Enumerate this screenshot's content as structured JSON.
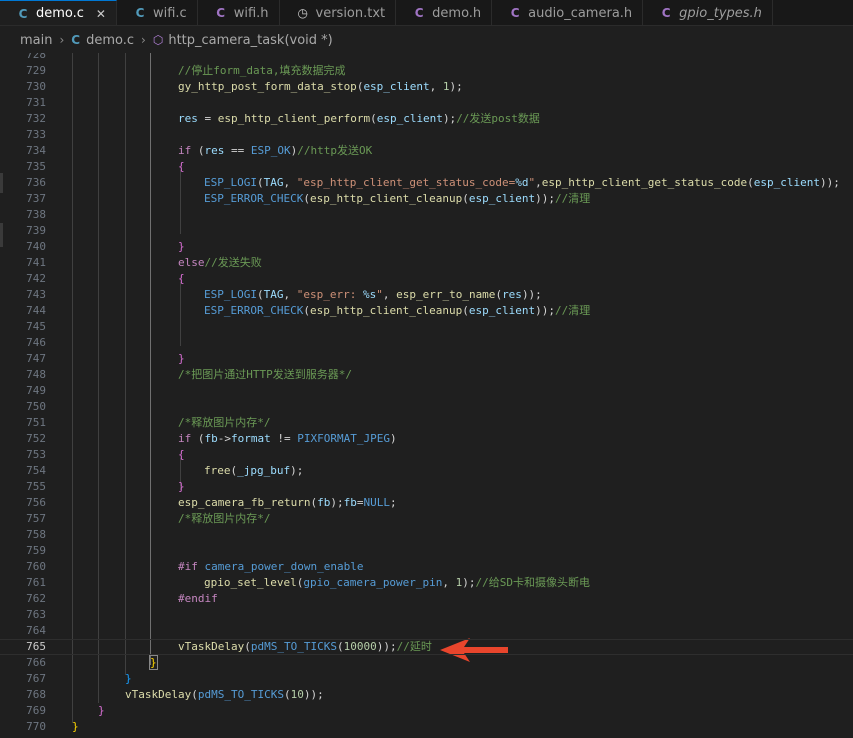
{
  "tabs": [
    {
      "label": "demo.c",
      "icon": "c-file-icon",
      "glyph": "C",
      "active": true
    },
    {
      "label": "wifi.c",
      "icon": "c-file-icon",
      "glyph": "C",
      "active": false
    },
    {
      "label": "wifi.h",
      "icon": "h-file-icon",
      "glyph": "C",
      "active": false
    },
    {
      "label": "version.txt",
      "icon": "txt-file-icon",
      "glyph": "◷",
      "active": false
    },
    {
      "label": "demo.h",
      "icon": "h-file-icon",
      "glyph": "C",
      "active": false
    },
    {
      "label": "audio_camera.h",
      "icon": "h-file-icon",
      "glyph": "C",
      "active": false
    },
    {
      "label": "gpio_types.h",
      "icon": "h-file-icon",
      "glyph": "C",
      "active": false
    }
  ],
  "tab_close_glyph": "✕",
  "breadcrumb": {
    "folder": "main",
    "file": "demo.c",
    "file_glyph": "C",
    "symbol": "http_camera_task(void *)",
    "symbol_glyph": "⬡",
    "sep": "›"
  },
  "current_line": 765,
  "lines": [
    {
      "n": "728",
      "segs": []
    },
    {
      "n": "729",
      "segs": [
        [
          "cm",
          "//停止form_data,填充数据完成"
        ]
      ]
    },
    {
      "n": "730",
      "segs": [
        [
          "fn",
          "gy_http_post_form_data_stop"
        ],
        [
          "p",
          "("
        ],
        [
          "var",
          "esp_client"
        ],
        [
          "p",
          ", "
        ],
        [
          "num",
          "1"
        ],
        [
          "p",
          ");"
        ]
      ]
    },
    {
      "n": "731",
      "segs": []
    },
    {
      "n": "732",
      "segs": [
        [
          "var",
          "res"
        ],
        [
          "p",
          " = "
        ],
        [
          "fn",
          "esp_http_client_perform"
        ],
        [
          "p",
          "("
        ],
        [
          "var",
          "esp_client"
        ],
        [
          "p",
          ");"
        ],
        [
          "cm",
          "//发送post数据"
        ]
      ]
    },
    {
      "n": "733",
      "segs": []
    },
    {
      "n": "734",
      "segs": [
        [
          "kw",
          "if"
        ],
        [
          "p",
          " ("
        ],
        [
          "var",
          "res"
        ],
        [
          "p",
          " == "
        ],
        [
          "mac",
          "ESP_OK"
        ],
        [
          "p",
          ")"
        ],
        [
          "cm",
          "//http发送OK"
        ]
      ]
    },
    {
      "n": "735",
      "segs": [
        [
          "brace",
          "{"
        ]
      ]
    },
    {
      "n": "736",
      "segs": [
        [
          "mac",
          "ESP_LOGI"
        ],
        [
          "p",
          "("
        ],
        [
          "var",
          "TAG"
        ],
        [
          "p",
          ", "
        ],
        [
          "str",
          "\"esp_http_client_get_status_code="
        ],
        [
          "fmt",
          "%d"
        ],
        [
          "str",
          "\""
        ],
        [
          "p",
          ","
        ],
        [
          "fn",
          "esp_http_client_get_status_code"
        ],
        [
          "p",
          "("
        ],
        [
          "var",
          "esp_client"
        ],
        [
          "p",
          "));"
        ]
      ]
    },
    {
      "n": "737",
      "segs": [
        [
          "mac",
          "ESP_ERROR_CHECK"
        ],
        [
          "p",
          "("
        ],
        [
          "fn",
          "esp_http_client_cleanup"
        ],
        [
          "p",
          "("
        ],
        [
          "var",
          "esp_client"
        ],
        [
          "p",
          "));"
        ],
        [
          "cm",
          "//清理"
        ]
      ]
    },
    {
      "n": "738",
      "segs": []
    },
    {
      "n": "739",
      "segs": []
    },
    {
      "n": "740",
      "segs": [
        [
          "brace",
          "}"
        ]
      ]
    },
    {
      "n": "741",
      "segs": [
        [
          "kw",
          "else"
        ],
        [
          "cm",
          "//发送失败"
        ]
      ]
    },
    {
      "n": "742",
      "segs": [
        [
          "brace",
          "{"
        ]
      ]
    },
    {
      "n": "743",
      "segs": [
        [
          "mac",
          "ESP_LOGI"
        ],
        [
          "p",
          "("
        ],
        [
          "var",
          "TAG"
        ],
        [
          "p",
          ", "
        ],
        [
          "str",
          "\"esp_err: "
        ],
        [
          "fmt",
          "%s"
        ],
        [
          "str",
          "\""
        ],
        [
          "p",
          ", "
        ],
        [
          "fn",
          "esp_err_to_name"
        ],
        [
          "p",
          "("
        ],
        [
          "var",
          "res"
        ],
        [
          "p",
          "));"
        ]
      ]
    },
    {
      "n": "744",
      "segs": [
        [
          "mac",
          "ESP_ERROR_CHECK"
        ],
        [
          "p",
          "("
        ],
        [
          "fn",
          "esp_http_client_cleanup"
        ],
        [
          "p",
          "("
        ],
        [
          "var",
          "esp_client"
        ],
        [
          "p",
          "));"
        ],
        [
          "cm",
          "//清理"
        ]
      ]
    },
    {
      "n": "745",
      "segs": []
    },
    {
      "n": "746",
      "segs": []
    },
    {
      "n": "747",
      "segs": [
        [
          "brace",
          "}"
        ]
      ]
    },
    {
      "n": "748",
      "segs": [
        [
          "cm",
          "/*把图片通过HTTP发送到服务器*/"
        ]
      ]
    },
    {
      "n": "749",
      "segs": []
    },
    {
      "n": "750",
      "segs": []
    },
    {
      "n": "751",
      "segs": [
        [
          "cm",
          "/*释放图片内存*/"
        ]
      ]
    },
    {
      "n": "752",
      "segs": [
        [
          "kw",
          "if"
        ],
        [
          "p",
          " ("
        ],
        [
          "var",
          "fb"
        ],
        [
          "p",
          "->"
        ],
        [
          "var",
          "format"
        ],
        [
          "p",
          " != "
        ],
        [
          "mac",
          "PIXFORMAT_JPEG"
        ],
        [
          "p",
          ")"
        ]
      ]
    },
    {
      "n": "753",
      "segs": [
        [
          "brace",
          "{"
        ]
      ]
    },
    {
      "n": "754",
      "segs": [
        [
          "fn",
          "free"
        ],
        [
          "p",
          "("
        ],
        [
          "var",
          "_jpg_buf"
        ],
        [
          "p",
          ");"
        ]
      ]
    },
    {
      "n": "755",
      "segs": [
        [
          "brace",
          "}"
        ]
      ]
    },
    {
      "n": "756",
      "segs": [
        [
          "fn",
          "esp_camera_fb_return"
        ],
        [
          "p",
          "("
        ],
        [
          "var",
          "fb"
        ],
        [
          "p",
          ");"
        ],
        [
          "var",
          "fb"
        ],
        [
          "p",
          "="
        ],
        [
          "mac",
          "NULL"
        ],
        [
          "p",
          ";"
        ]
      ]
    },
    {
      "n": "757",
      "segs": [
        [
          "cm",
          "/*释放图片内存*/"
        ]
      ]
    },
    {
      "n": "758",
      "segs": []
    },
    {
      "n": "759",
      "segs": []
    },
    {
      "n": "760",
      "segs": [
        [
          "pp",
          "#if"
        ],
        [
          "p",
          " "
        ],
        [
          "mac",
          "camera_power_down_enable"
        ]
      ]
    },
    {
      "n": "761",
      "segs": [
        [
          "fn",
          "gpio_set_level"
        ],
        [
          "p",
          "("
        ],
        [
          "mac",
          "gpio_camera_power_pin"
        ],
        [
          "p",
          ", "
        ],
        [
          "num",
          "1"
        ],
        [
          "p",
          ");"
        ],
        [
          "cm",
          "//给SD卡和摄像头断电"
        ]
      ]
    },
    {
      "n": "762",
      "segs": [
        [
          "pp",
          "#endif"
        ]
      ]
    },
    {
      "n": "763",
      "segs": []
    },
    {
      "n": "764",
      "segs": []
    },
    {
      "n": "765",
      "segs": [
        [
          "fn",
          "vTaskDelay"
        ],
        [
          "p",
          "("
        ],
        [
          "mac",
          "pdMS_TO_TICKS"
        ],
        [
          "p",
          "("
        ],
        [
          "num",
          "10000"
        ],
        [
          "p",
          "));"
        ],
        [
          "cm",
          "//延时"
        ]
      ]
    },
    {
      "n": "766",
      "segs": [
        [
          "brace3",
          "}"
        ]
      ]
    },
    {
      "n": "767",
      "segs": [
        [
          "brace2",
          "}"
        ]
      ]
    },
    {
      "n": "768",
      "segs": [
        [
          "fn",
          "vTaskDelay"
        ],
        [
          "p",
          "("
        ],
        [
          "mac",
          "pdMS_TO_TICKS"
        ],
        [
          "p",
          "("
        ],
        [
          "num",
          "10"
        ],
        [
          "p",
          "));"
        ]
      ]
    },
    {
      "n": "769",
      "segs": [
        [
          "brace",
          "}"
        ]
      ]
    },
    {
      "n": "770",
      "segs": [
        [
          "brace3",
          "}"
        ]
      ]
    }
  ],
  "annotation": {
    "shape": "red-arrow",
    "color": "#e8452c"
  }
}
